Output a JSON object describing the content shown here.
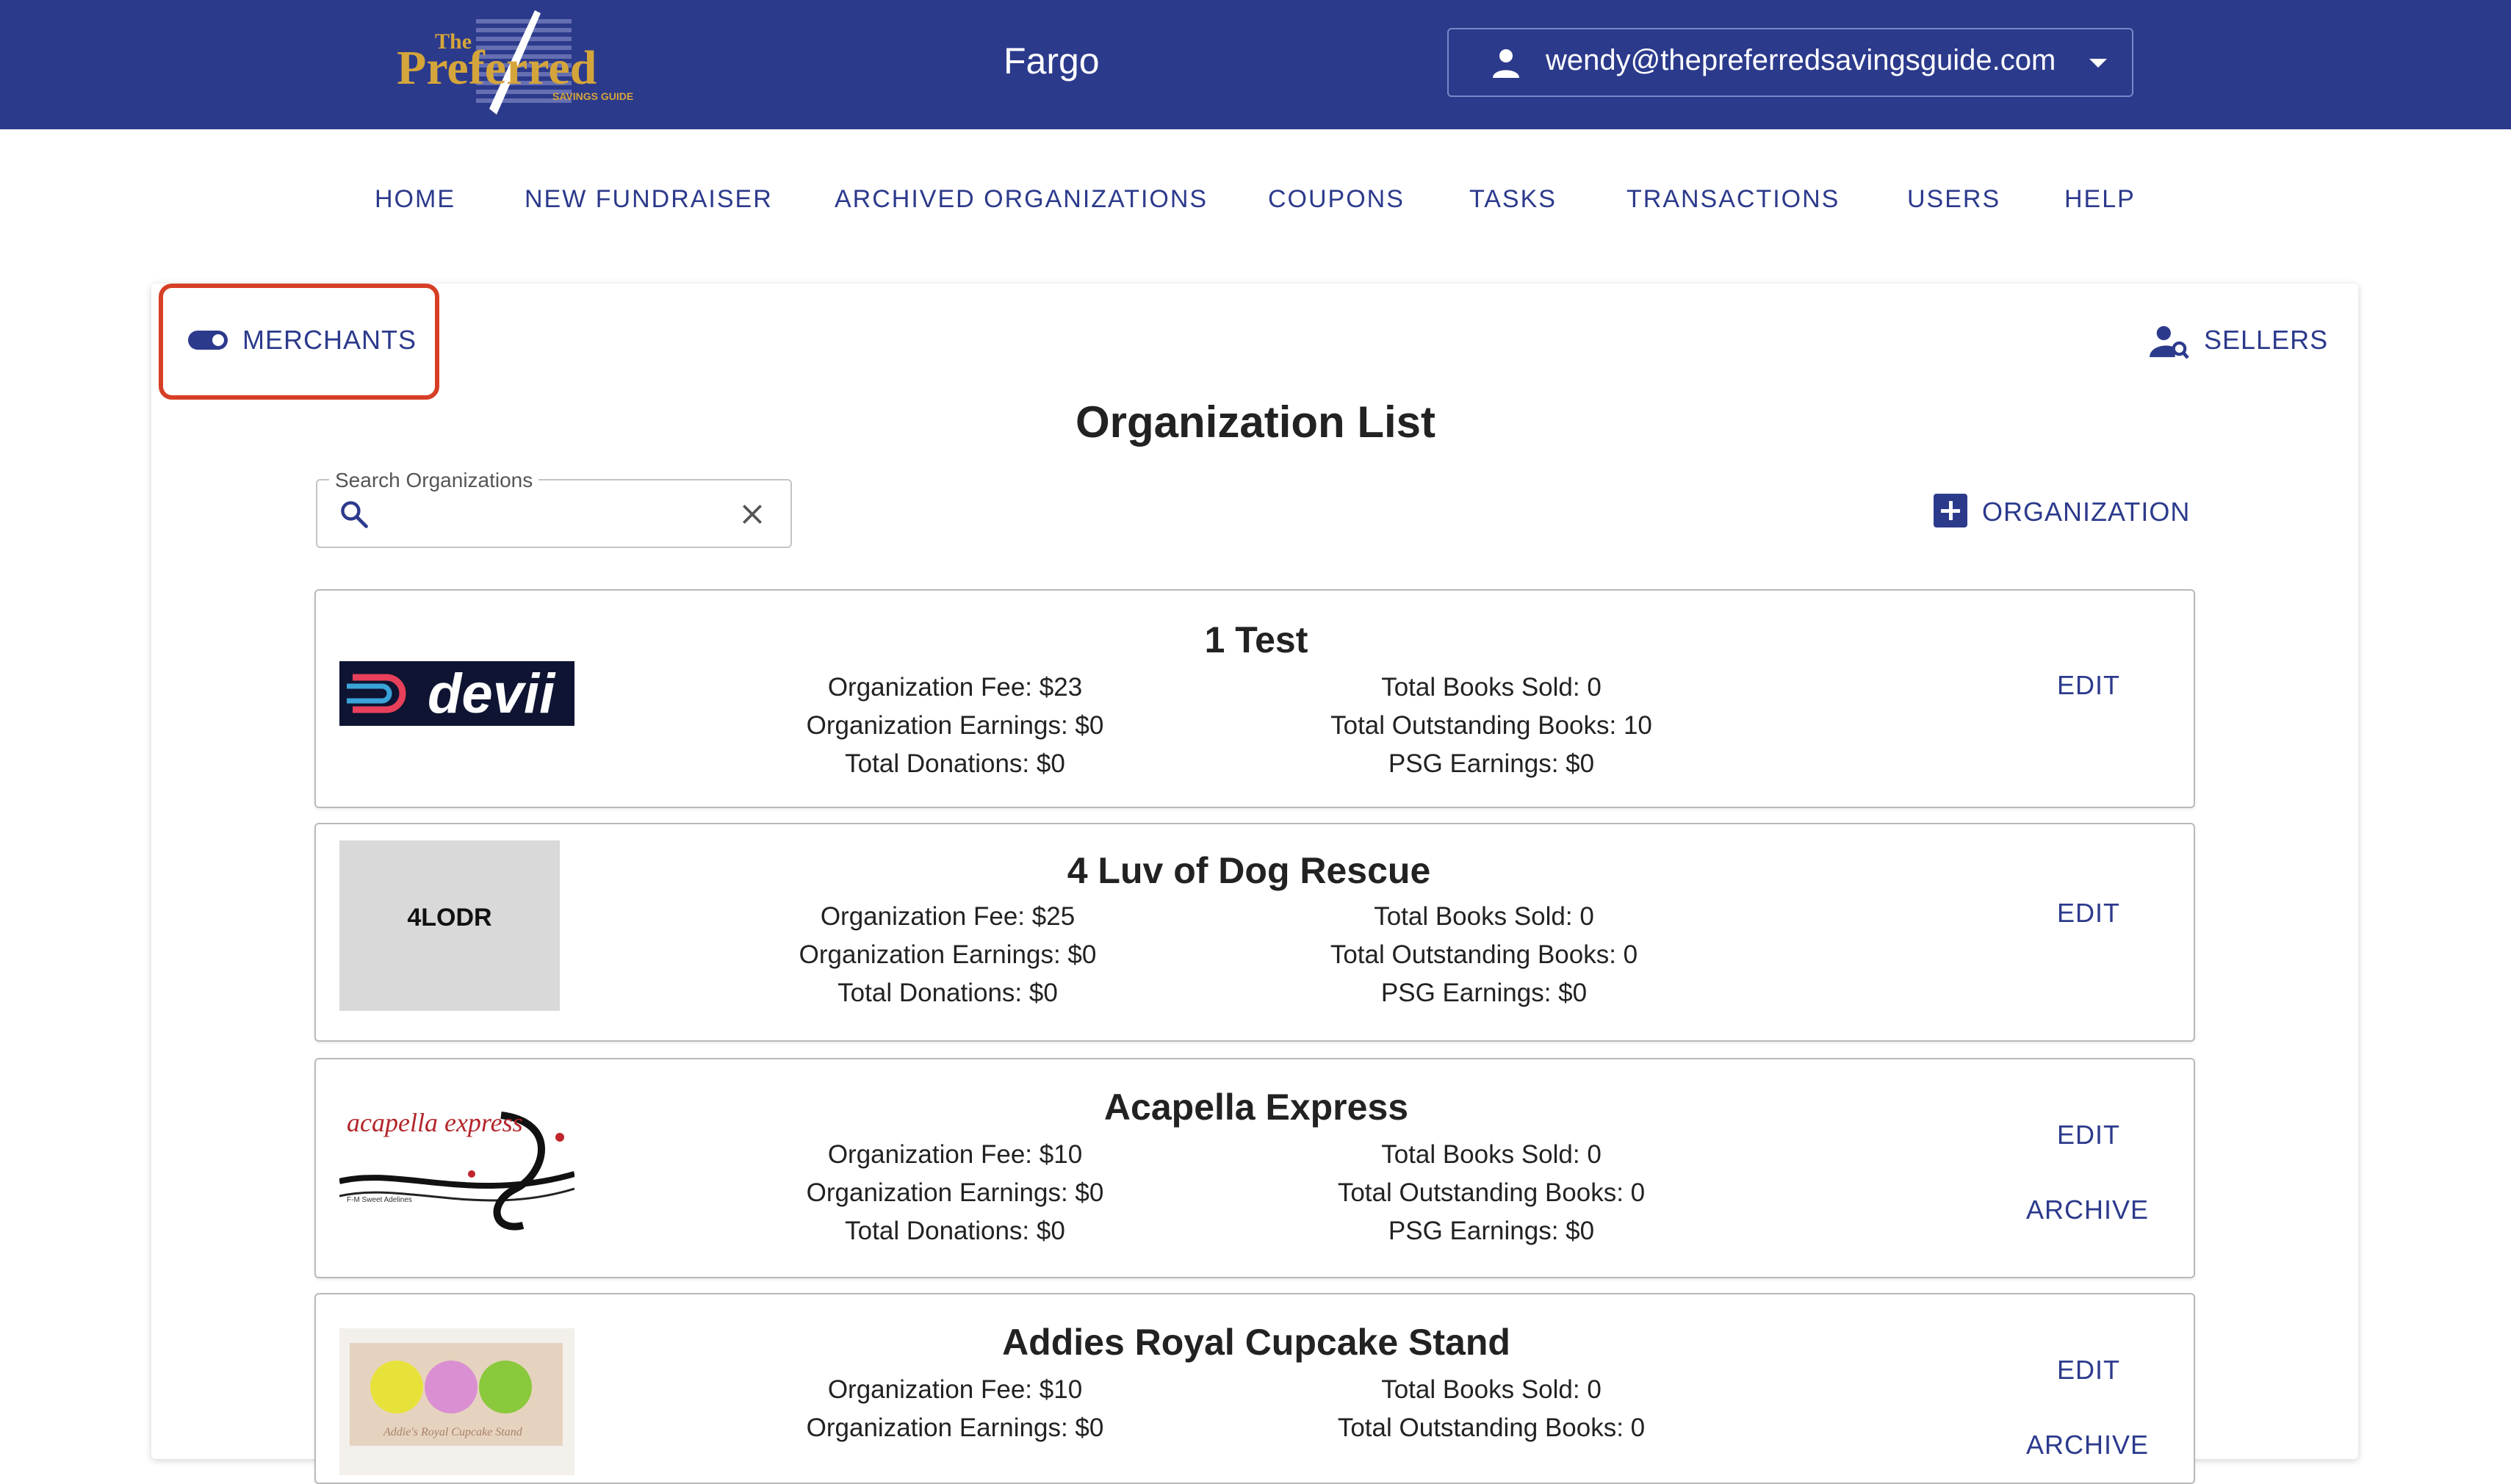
{
  "header": {
    "logo_text_top": "The",
    "logo_text_main": "Preferred",
    "logo_text_sub": "SAVINGS GUIDE",
    "city": "Fargo",
    "user_email": "wendy@thepreferredsavingsguide.com"
  },
  "nav": {
    "items": [
      {
        "label": "HOME"
      },
      {
        "label": "NEW FUNDRAISER"
      },
      {
        "label": "ARCHIVED ORGANIZATIONS"
      },
      {
        "label": "COUPONS"
      },
      {
        "label": "TASKS"
      },
      {
        "label": "TRANSACTIONS"
      },
      {
        "label": "USERS"
      },
      {
        "label": "HELP"
      }
    ]
  },
  "toolbar": {
    "merchants_label": "MERCHANTS",
    "sellers_label": "SELLERS"
  },
  "page": {
    "title": "Organization List"
  },
  "search": {
    "label": "Search Organizations",
    "value": "",
    "placeholder": ""
  },
  "add_org": {
    "label": "ORGANIZATION"
  },
  "organizations": [
    {
      "name": "1 Test",
      "logo_text": "devii",
      "org_fee": "Organization Fee: $23",
      "org_earnings": "Organization Earnings: $0",
      "donations": "Total Donations: $0",
      "books_sold": "Total Books Sold: 0",
      "outstanding": "Total Outstanding Books: 10",
      "psg_earnings": "PSG Earnings: $0",
      "edit_label": "EDIT"
    },
    {
      "name": "4 Luv of Dog Rescue",
      "logo_text": "4LODR",
      "org_fee": "Organization Fee: $25",
      "org_earnings": "Organization Earnings: $0",
      "donations": "Total Donations: $0",
      "books_sold": "Total Books Sold: 0",
      "outstanding": "Total Outstanding Books: 0",
      "psg_earnings": "PSG Earnings: $0",
      "edit_label": "EDIT"
    },
    {
      "name": "Acapella Express",
      "logo_text": "acapella express",
      "logo_subtext": "F-M Sweet Adelines",
      "org_fee": "Organization Fee: $10",
      "org_earnings": "Organization Earnings: $0",
      "donations": "Total Donations: $0",
      "books_sold": "Total Books Sold: 0",
      "outstanding": "Total Outstanding Books: 0",
      "psg_earnings": "PSG Earnings: $0",
      "edit_label": "EDIT",
      "archive_label": "ARCHIVE"
    },
    {
      "name": "Addies Royal Cupcake Stand",
      "logo_text": "Addie's Royal Cupcake Stand",
      "org_fee": "Organization Fee: $10",
      "org_earnings": "Organization Earnings: $0",
      "books_sold": "Total Books Sold: 0",
      "outstanding": "Total Outstanding Books: 0",
      "edit_label": "EDIT",
      "archive_label": "ARCHIVE"
    }
  ],
  "colors": {
    "brand_navy": "#2c3a8c",
    "highlight_red": "#d63f26",
    "logo_gold": "#d4a53a"
  }
}
